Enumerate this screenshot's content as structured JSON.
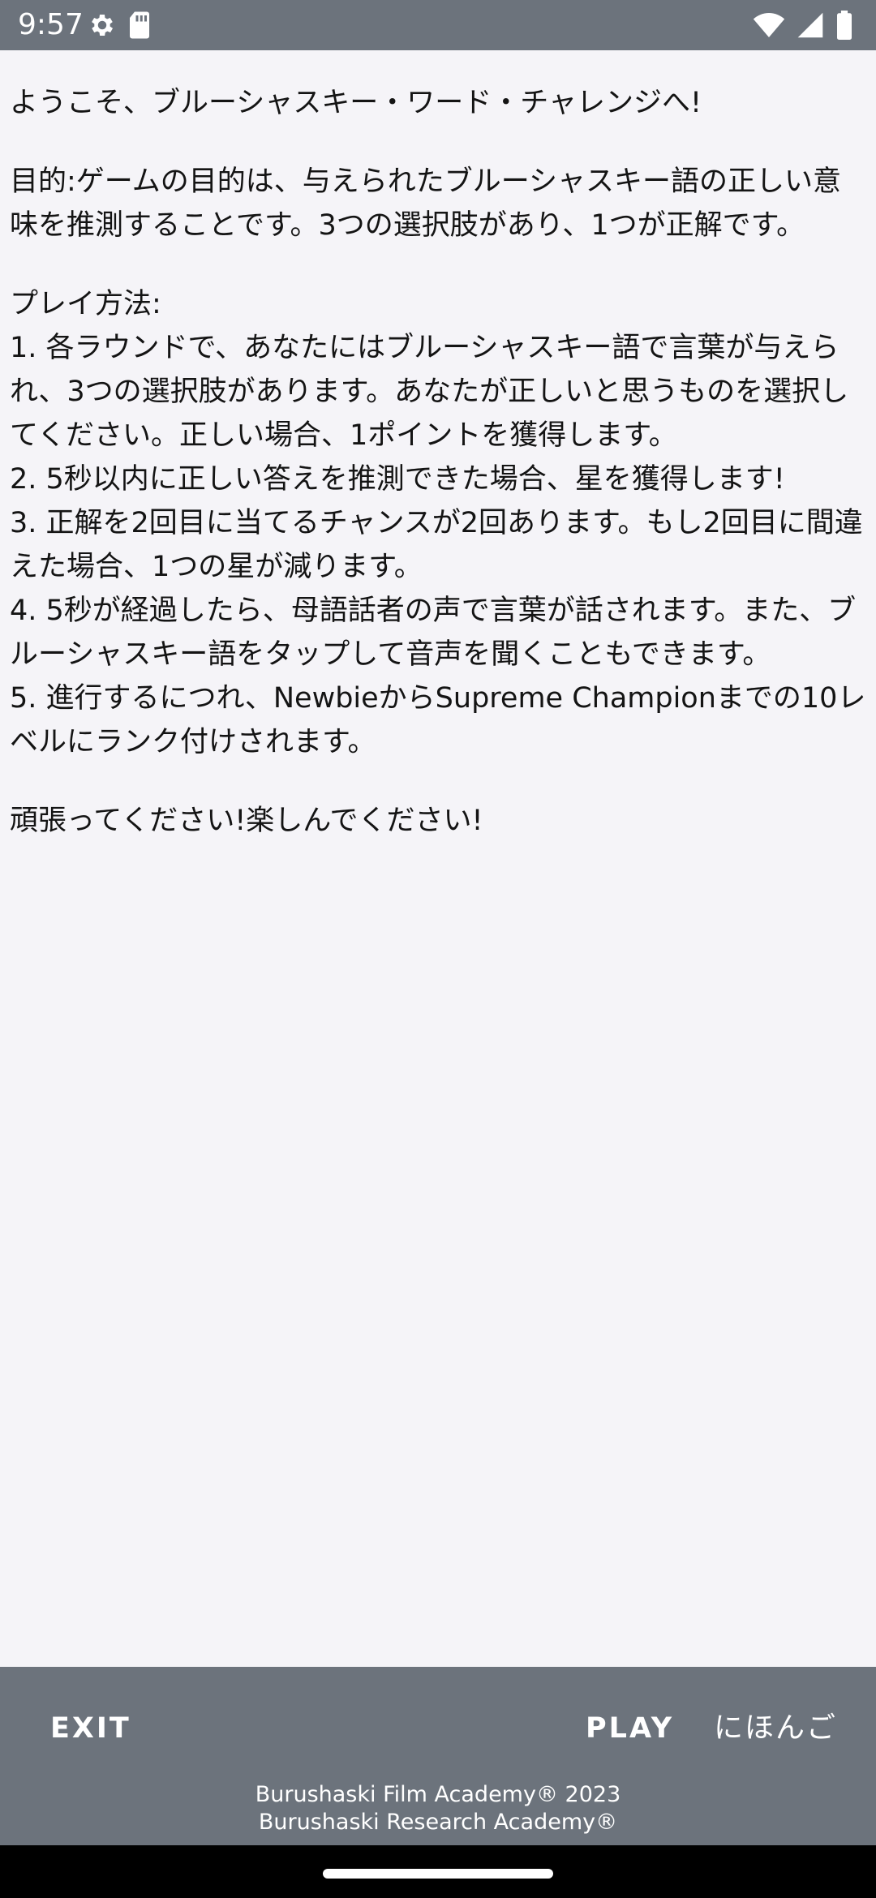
{
  "status_bar": {
    "time": "9:57",
    "icons_left": [
      "settings-icon",
      "sd-card-icon"
    ],
    "icons_right": [
      "wifi-icon",
      "cell-signal-icon",
      "battery-icon"
    ]
  },
  "content": {
    "welcome": "ようこそ、ブルーシャスキー・ワード・チャレンジへ!",
    "objective": "目的:ゲームの目的は、与えられたブルーシャスキー語の正しい意味を推測することです。3つの選択肢があり、1つが正解です。",
    "how_to_play_title": "プレイ方法:",
    "rules": [
      "1. 各ラウンドで、あなたにはブルーシャスキー語で言葉が与えられ、3つの選択肢があります。あなたが正しいと思うものを選択してください。正しい場合、1ポイントを獲得します。",
      "2. 5秒以内に正しい答えを推測できた場合、星を獲得します!",
      "3. 正解を2回目に当てるチャンスが2回あります。もし2回目に間違えた場合、1つの星が減ります。",
      "4. 5秒が経過したら、母語話者の声で言葉が話されます。また、ブルーシャスキー語をタップして音声を聞くこともできます。",
      "5. 進行するにつれ、NewbieからSupreme Championまでの10レベルにランク付けされます。"
    ],
    "closing": "頑張ってください!楽しんでください!"
  },
  "bottom_bar": {
    "exit_label": "EXIT",
    "play_label": "PLAY",
    "language_label": "にほんご",
    "footer_line1": "Burushaski Film Academy® 2023",
    "footer_line2": "Burushaski Research Academy®"
  },
  "colors": {
    "bar_background": "#6c737c",
    "page_background": "#f5f4f8",
    "text": "#141414",
    "nav_background": "#000000"
  }
}
